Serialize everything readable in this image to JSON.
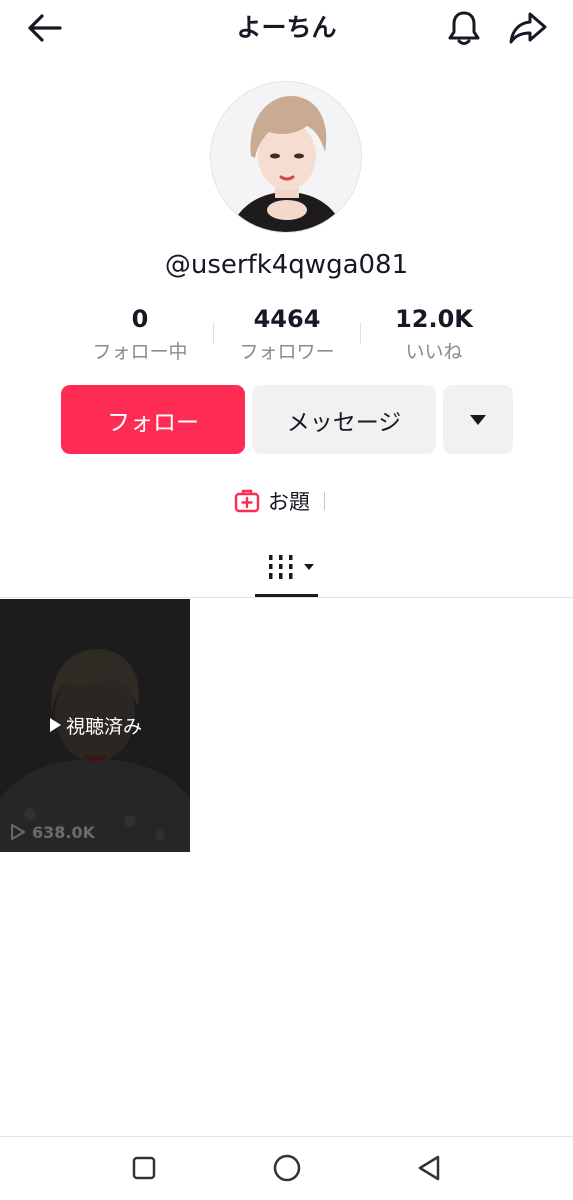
{
  "header": {
    "title": "よーちん",
    "back_icon": "arrow-left-icon",
    "bell_icon": "bell-icon",
    "share_icon": "share-icon"
  },
  "profile": {
    "username": "@userfk4qwga081",
    "avatar_icon": "avatar"
  },
  "stats": [
    {
      "value": "0",
      "label": "フォロー中"
    },
    {
      "value": "4464",
      "label": "フォロワー"
    },
    {
      "value": "12.0K",
      "label": "いいね"
    }
  ],
  "actions": {
    "follow_label": "フォロー",
    "message_label": "メッセージ",
    "more_icon": "caret-down-icon"
  },
  "topic": {
    "label": "お題",
    "icon": "topic-add-icon"
  },
  "tabs": {
    "videos_icon": "grid-columns-icon",
    "dropdown_icon": "caret-down-icon"
  },
  "videos": [
    {
      "overlay_label": "視聴済み",
      "views": "638.0K"
    }
  ],
  "colors": {
    "accent": "#fe2c55",
    "text": "#161823",
    "muted": "#8a8b91",
    "button_bg": "#f1f1f2"
  },
  "navbar": {
    "recents_icon": "square-icon",
    "home_icon": "circle-icon",
    "back_icon": "triangle-back-icon"
  }
}
